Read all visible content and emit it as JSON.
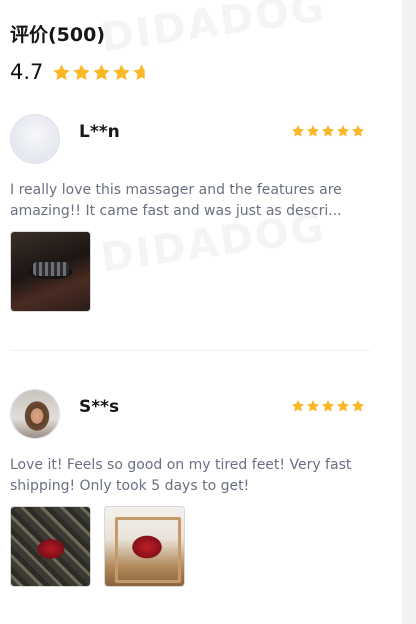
{
  "section": {
    "title": "评价(500)",
    "average_rating": "4.7",
    "average_rating_value": 4.7,
    "watermark_text": "DIDADOG"
  },
  "colors": {
    "star": "#fbb725",
    "review_text": "#6a6f82",
    "heading": "#161616"
  },
  "reviews": [
    {
      "name": "L**n",
      "rating": 5,
      "text": "I really love this massager and the features are amazing!! It came fast and was just as descri...",
      "avatar": "default-avatar-icon",
      "photos": [
        "massager-photo"
      ]
    },
    {
      "name": "S**s",
      "rating": 5,
      "text": "Love it! Feels so good on my tired feet! Very fast shipping! Only took 5 days to get!",
      "avatar": "user-photo",
      "photos": [
        "massager-photo",
        "massager-in-box-photo"
      ]
    }
  ]
}
